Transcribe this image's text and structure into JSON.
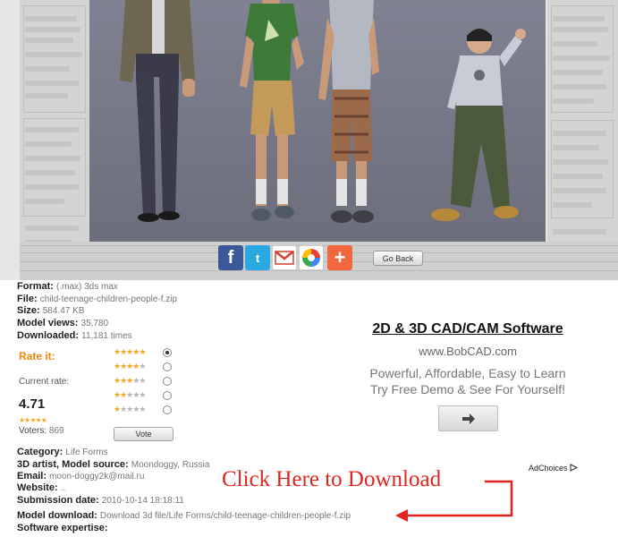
{
  "share": {
    "facebook_glyph": "f",
    "twitter_glyph": "t",
    "plus_glyph": "+",
    "go_back": "Go Back"
  },
  "info": {
    "format_label": "Format:",
    "format_value": "(.max) 3ds max",
    "file_label": "File:",
    "file_value": "child-teenage-children-people-f.zip",
    "size_label": "Size:",
    "size_value": "584.47 KB",
    "views_label": "Model views:",
    "views_value": "35,780",
    "downloaded_label": "Downloaded:",
    "downloaded_value": "11,181 times"
  },
  "rating": {
    "rate_it_label": "Rate it:",
    "current_rate_label": "Current rate:",
    "current_rate_value": "4.71",
    "voters_label": "Voters:",
    "voters_value": "869",
    "options": [
      5,
      4,
      3,
      2,
      1
    ],
    "selected": 5,
    "current_stars": 5,
    "vote_button": "Vote"
  },
  "details": {
    "category_label": "Category:",
    "category_value": "Life Forms",
    "artist_label": "3D artist, Model source:",
    "artist_value": "Moondoggy, Russia",
    "email_label": "Email:",
    "email_value": "moon-doggy2k@mail.ru",
    "website_label": "Website:",
    "website_value": "..",
    "submission_label": "Submission date:",
    "submission_value": "2010-10-14 18:18:11",
    "download_label": "Model download:",
    "download_value": "Download 3d file/Life Forms/child-teenage-children-people-f.zip",
    "software_label": "Software expertise:"
  },
  "ad": {
    "title": "2D & 3D CAD/CAM Software",
    "url": "www.BobCAD.com",
    "line1": "Powerful, Affordable, Easy to Learn",
    "line2": "Try Free Demo & See For Yourself!",
    "adchoices": "AdChoices"
  },
  "callout": {
    "text": "Click Here to Download"
  },
  "colors": {
    "accent_orange": "#f0830f",
    "callout_red": "#e0241e",
    "render_bg": "#7c7e8c",
    "star": "#f5a623"
  }
}
